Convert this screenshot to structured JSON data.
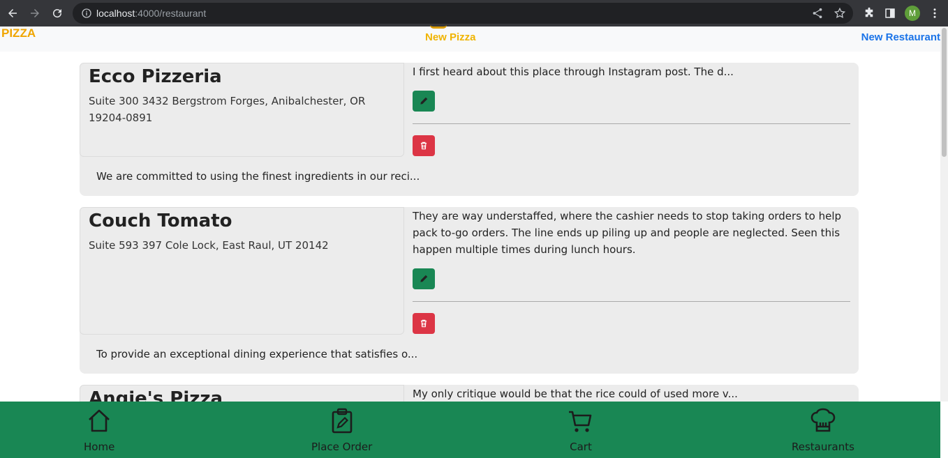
{
  "browser": {
    "url_host": "localhost",
    "url_path": ":4000/restaurant",
    "profile_initial": "M"
  },
  "topnav": {
    "brand": "PIZZA",
    "new_pizza": "New Pizza",
    "new_restaurant": "New Restaurant"
  },
  "restaurants": [
    {
      "name": "Ecco Pizzeria",
      "address": "Suite 300 3432 Bergstrom Forges, Anibalchester, OR 19204-0891",
      "review": "I first heard about this place through Instagram post. The d...",
      "mission": "We are committed to using the finest ingredients in our reci..."
    },
    {
      "name": "Couch Tomato",
      "address": "Suite 593 397 Cole Lock, East Raul, UT 20142",
      "review": "They are way understaffed, where the cashier needs to stop taking orders to help pack to-go orders. The line ends up piling up and people are neglected. Seen this happen multiple times during lunch hours.",
      "mission": "To provide an exceptional dining experience that satisfies o..."
    },
    {
      "name": "Angie's Pizza",
      "review": "My only critique would be that the rice could of used more v..."
    }
  ],
  "bottomnav": {
    "home": "Home",
    "place_order": "Place Order",
    "cart": "Cart",
    "restaurants": "Restaurants"
  },
  "colors": {
    "brand": "#f0a500",
    "link": "#1a73e8",
    "edit": "#198754",
    "delete": "#dc3545",
    "bottomnav": "#198754",
    "card": "#ececec"
  }
}
